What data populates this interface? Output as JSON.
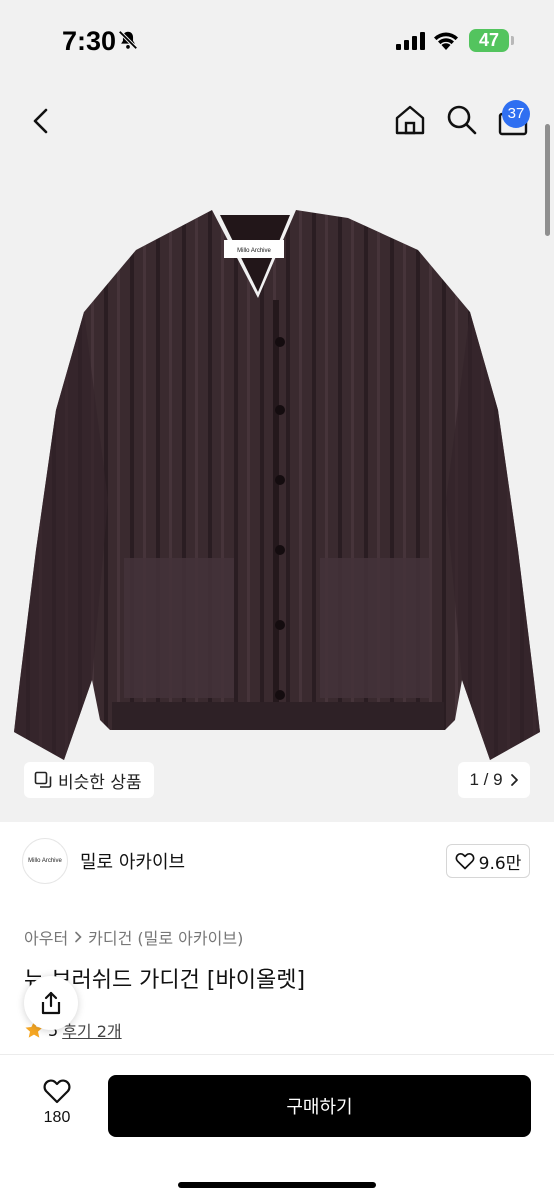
{
  "status": {
    "time": "7:30",
    "battery": "47"
  },
  "nav": {
    "cart_count": "37"
  },
  "gallery": {
    "similar_label": "비슷한 상품",
    "counter": "1 / 9",
    "product_label_text": "Millo Archive"
  },
  "brand": {
    "logo_text": "Millo Archive",
    "name": "밀로 아카이브",
    "likes": "9.6만"
  },
  "product": {
    "category_main": "아우터",
    "category_sub": "카디건 (밀로 아카이브)",
    "title": "뉴 브러쉬드 가디건 [바이올렛]",
    "rating": "5",
    "review_label": "후기 2개"
  },
  "bottom": {
    "like_count": "180",
    "buy_label": "구매하기"
  },
  "colors": {
    "accent_badge": "#2f6ff1",
    "battery": "#53c45e",
    "cardigan": "#3a2a2f",
    "star": "#f5a623"
  }
}
